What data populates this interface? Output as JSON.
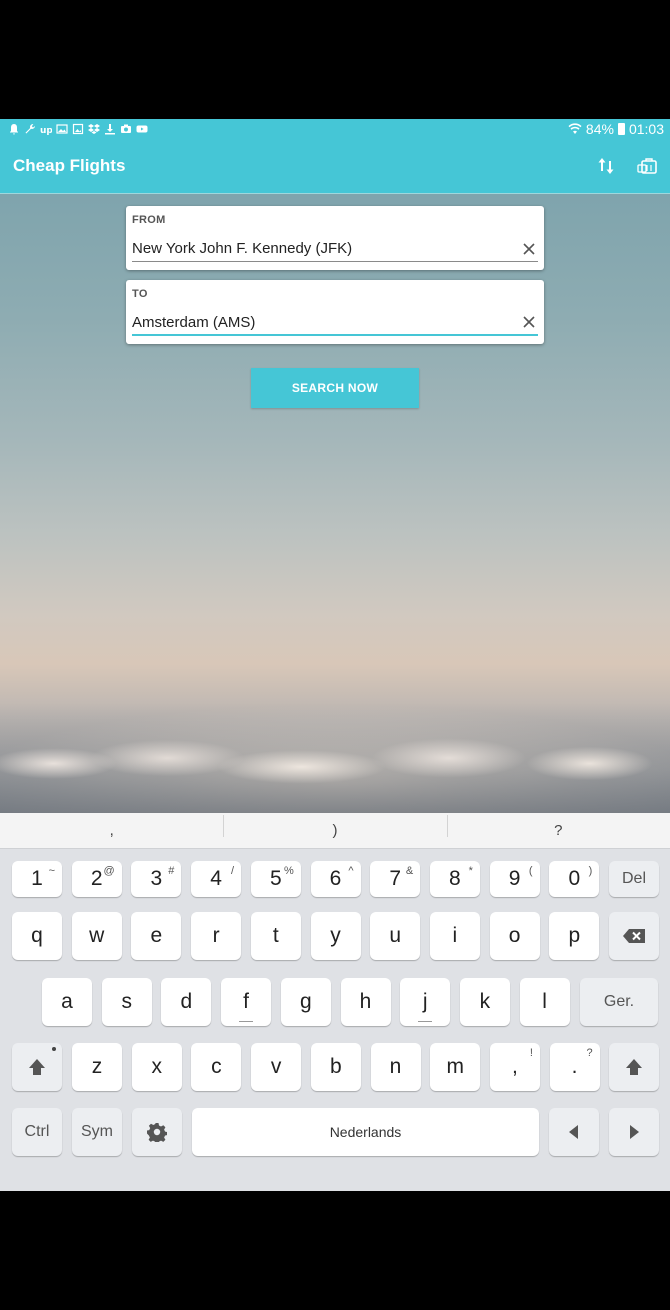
{
  "status_bar": {
    "battery": "84%",
    "time": "01:03",
    "left_icons": [
      "bell-icon",
      "wrench-icon",
      "up-icon",
      "image-icon",
      "gallery-icon",
      "dropbox-icon",
      "download-icon",
      "screenshot-icon",
      "youtube-icon"
    ]
  },
  "app_bar": {
    "title": "Cheap Flights",
    "actions": [
      "swap-icon",
      "bag-icon"
    ]
  },
  "form": {
    "from_label": "FROM",
    "from_value": "New York John F. Kennedy (JFK)",
    "to_label": "TO",
    "to_value": "Amsterdam (AMS)",
    "search_label": "SEARCH NOW"
  },
  "colors": {
    "accent": "#45c6d6"
  },
  "keyboard": {
    "suggestions": [
      ",",
      ")",
      "?"
    ],
    "row1": [
      {
        "k": "1",
        "s": "~"
      },
      {
        "k": "2",
        "s": "@"
      },
      {
        "k": "3",
        "s": "#"
      },
      {
        "k": "4",
        "s": "/"
      },
      {
        "k": "5",
        "s": "%"
      },
      {
        "k": "6",
        "s": "^"
      },
      {
        "k": "7",
        "s": "&"
      },
      {
        "k": "8",
        "s": "*"
      },
      {
        "k": "9",
        "s": "("
      },
      {
        "k": "0",
        "s": ")"
      },
      {
        "k": "Del",
        "s": ""
      }
    ],
    "row2": [
      "q",
      "w",
      "e",
      "r",
      "t",
      "y",
      "u",
      "i",
      "o",
      "p"
    ],
    "row3": [
      "a",
      "s",
      "d",
      "f",
      "g",
      "h",
      "j",
      "k",
      "l"
    ],
    "row3_action": "Ger.",
    "row4": [
      "z",
      "x",
      "c",
      "v",
      "b",
      "n",
      "m"
    ],
    "row4_punct": [
      {
        "k": ",",
        "s": "!"
      },
      {
        "k": ".",
        "s": "?"
      }
    ],
    "ctrl": "Ctrl",
    "sym": "Sym",
    "space": "Nederlands"
  }
}
